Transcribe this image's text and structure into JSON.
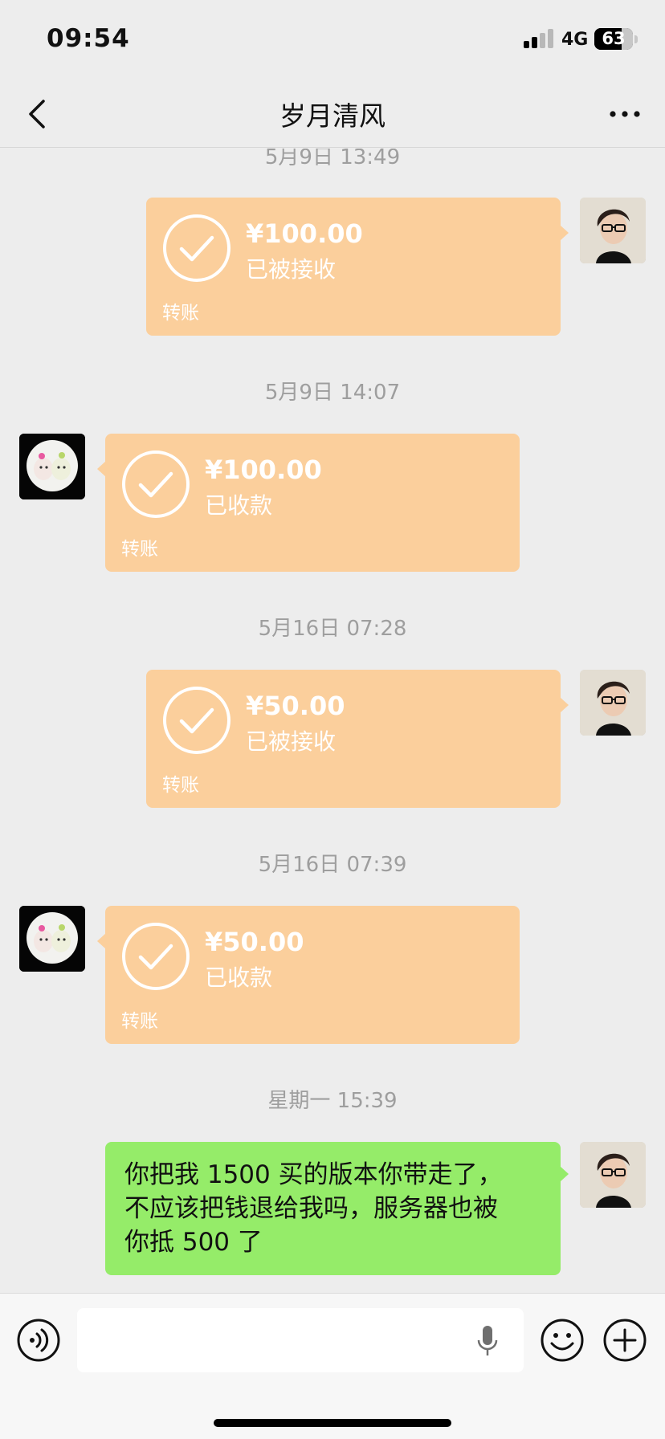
{
  "status_bar": {
    "time": "09:54",
    "network": "4G",
    "battery": "63",
    "battery_level": 0.63
  },
  "nav": {
    "title": "岁月清风"
  },
  "messages": {
    "ts0": "5月9日 13:49",
    "m1": {
      "amount": "¥100.00",
      "status": "已被接收",
      "label": "转账"
    },
    "ts1": "5月9日 14:07",
    "m2": {
      "amount": "¥100.00",
      "status": "已收款",
      "label": "转账"
    },
    "ts2": "5月16日 07:28",
    "m3": {
      "amount": "¥50.00",
      "status": "已被接收",
      "label": "转账"
    },
    "ts3": "5月16日 07:39",
    "m4": {
      "amount": "¥50.00",
      "status": "已收款",
      "label": "转账"
    },
    "ts4": "星期一 15:39",
    "m5": {
      "line1": "你把我 1500 买的版本你带走了，",
      "line2": "不应该把钱退给我吗，服务器也被",
      "line3": "你抵 500 了"
    }
  },
  "colors": {
    "transfer": "#fbcf9c",
    "my_text_bubble": "#95ec69",
    "background": "#ededed"
  },
  "icons": [
    "back-icon",
    "more-icon",
    "check-icon",
    "voice-icon",
    "mic-icon",
    "emoji-icon",
    "plus-icon"
  ]
}
